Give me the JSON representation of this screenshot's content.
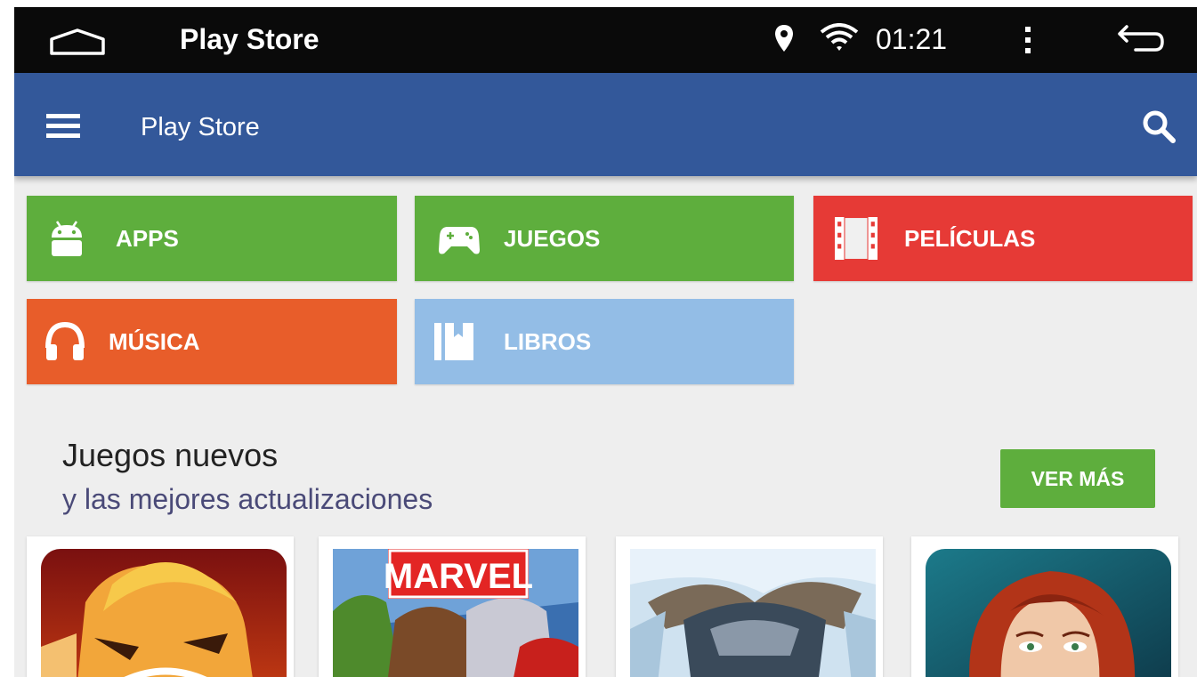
{
  "status_bar": {
    "title": "Play Store",
    "time": "01:21",
    "icons": [
      "home-icon",
      "location-pin-icon",
      "wifi-icon",
      "overflow-menu-icon",
      "back-icon"
    ]
  },
  "app_bar": {
    "title": "Play Store",
    "color": "#33589a",
    "icons": [
      "menu-icon",
      "search-icon"
    ]
  },
  "categories": [
    {
      "label": "APPS",
      "icon": "android-icon",
      "color": "#5eae3d"
    },
    {
      "label": "JUEGOS",
      "icon": "gamepad-icon",
      "color": "#5eae3d"
    },
    {
      "label": "PELÍCULAS",
      "icon": "film-icon",
      "color": "#e63a36"
    },
    {
      "label": "MÚSICA",
      "icon": "headphones-icon",
      "color": "#e85d2a"
    },
    {
      "label": "LIBROS",
      "icon": "book-icon",
      "color": "#93bde6"
    }
  ],
  "section": {
    "title": "Juegos nuevos",
    "subtitle": "y las mejores actualizaciones",
    "more_button": "VER MÁS"
  },
  "games": [
    {
      "art": "barbarian-warrior-art"
    },
    {
      "art": "marvel-heroes-art",
      "logo_text": "MARVEL"
    },
    {
      "art": "frost-warrior-art"
    },
    {
      "art": "red-haired-heroine-art"
    }
  ]
}
